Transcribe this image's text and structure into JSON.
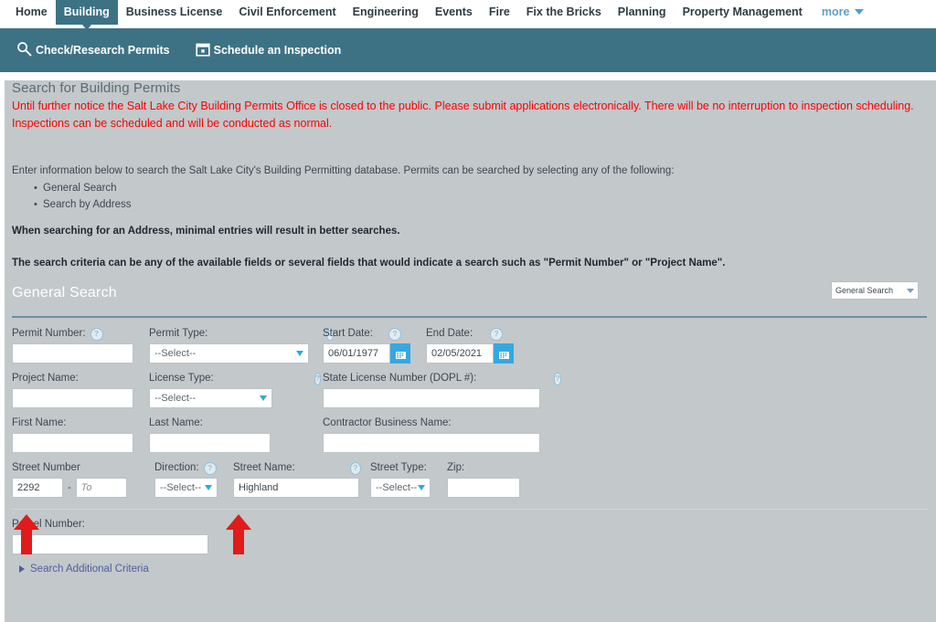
{
  "topnav": {
    "items": [
      {
        "label": "Home",
        "active": false
      },
      {
        "label": "Building",
        "active": true
      },
      {
        "label": "Business License",
        "active": false
      },
      {
        "label": "Civil Enforcement",
        "active": false
      },
      {
        "label": "Engineering",
        "active": false
      },
      {
        "label": "Events",
        "active": false
      },
      {
        "label": "Fire",
        "active": false
      },
      {
        "label": "Fix the Bricks",
        "active": false
      },
      {
        "label": "Planning",
        "active": false
      },
      {
        "label": "Property Management",
        "active": false
      }
    ],
    "more_label": "more",
    "more_icon": "chevron-down-icon",
    "active_color": "#3d7285",
    "more_color": "#5d9fc4"
  },
  "subbar": {
    "background": "#3d7285",
    "items": [
      {
        "label": "Check/Research Permits",
        "icon": "search-icon"
      },
      {
        "label": "Schedule an Inspection",
        "icon": "calendar-icon"
      }
    ]
  },
  "page": {
    "background": "#c3c8cb",
    "heading": "Search for Building Permits",
    "alert_color": "#fe0000",
    "alert": "Until further notice the Salt Lake City Building Permits Office is closed to the public.  Please submit applications electronically. There will be no interruption to inspection scheduling.  Inspections can be scheduled and will be conducted as normal.",
    "intro": "Enter information below to search the Salt Lake City's Building Permitting database. Permits can be searched by selecting any of the following:",
    "bullets": [
      "General Search",
      "Search by Address"
    ],
    "note_address": "When searching for an Address, minimal entries will result in better searches.",
    "note_criteria": "The search criteria can be any of the available fields or several fields that would indicate a search such as \"Permit Number\" or \"Project Name\"."
  },
  "general_search": {
    "title": "General Search",
    "search_type_selected": "General Search",
    "search_type_icon": "chevron-down-icon"
  },
  "form": {
    "help_icon": "question-mark-icon",
    "select_placeholder": "--Select--",
    "row1": {
      "permit_number": {
        "label": "Permit Number:",
        "value": "",
        "help": true
      },
      "permit_type": {
        "label": "Permit Type:",
        "value": "--Select--",
        "help": true
      },
      "start_date": {
        "label": "Start Date:",
        "value": "06/01/1977",
        "help": true,
        "icon": "calendar-icon"
      },
      "end_date": {
        "label": "End Date:",
        "value": "02/05/2021",
        "help": true,
        "icon": "calendar-icon"
      }
    },
    "row2": {
      "project_name": {
        "label": "Project Name:",
        "value": "",
        "help": false
      },
      "license_type": {
        "label": "License Type:",
        "value": "--Select--",
        "help": true
      },
      "state_license": {
        "label": "State License Number (DOPL #):",
        "value": "",
        "help": true
      }
    },
    "row3": {
      "first_name": {
        "label": "First Name:",
        "value": "",
        "help": false
      },
      "last_name": {
        "label": "Last Name:",
        "value": "",
        "help": false
      },
      "contractor": {
        "label": "Contractor Business Name:",
        "value": "",
        "help": false
      }
    },
    "row4": {
      "street_number": {
        "label": "Street Number",
        "value": "2292",
        "to_placeholder": "To",
        "to_value": "",
        "separator": "-"
      },
      "direction": {
        "label": "Direction:",
        "value": "--Select--",
        "help": true
      },
      "street_name": {
        "label": "Street Name:",
        "value": "Highland",
        "help": true
      },
      "street_type": {
        "label": "Street Type:",
        "value": "--Select--",
        "help": false
      },
      "zip": {
        "label": "Zip:",
        "value": "",
        "help": false
      }
    },
    "row5": {
      "parcel_number": {
        "label": "Parcel Number:",
        "value": ""
      }
    },
    "additional_criteria_link": "Search Additional Criteria"
  },
  "annotations": {
    "arrow_color": "#e01b1b",
    "arrows": [
      {
        "name": "arrow-street-number",
        "points_to": "street-number-input"
      },
      {
        "name": "arrow-street-name",
        "points_to": "street-name-input"
      }
    ]
  }
}
